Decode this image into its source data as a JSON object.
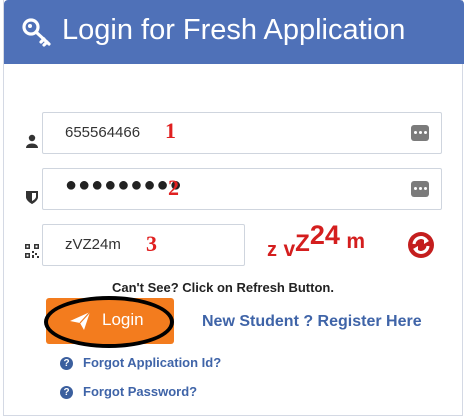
{
  "header": {
    "title": "Login for Fresh Application",
    "bg_color": "#4f71b8",
    "icon": "key-icon"
  },
  "fields": {
    "application_id": {
      "value": "655564466",
      "annotation": "1",
      "icon": "user-icon"
    },
    "password": {
      "value": "●●●●●●●●●",
      "annotation": "2",
      "icon": "shield-icon"
    },
    "captcha": {
      "value": "zVZ24m",
      "annotation": "3",
      "icon": "qr-code-icon"
    }
  },
  "captcha_image": {
    "part1": "z",
    "part2": "v",
    "part3": "Z",
    "part4": "24",
    "part5": "m",
    "color": "#d41e1e"
  },
  "hint": "Can't See? Click on Refresh Button.",
  "login_button": {
    "label": "Login",
    "color": "#f37c1e"
  },
  "register_link": "New Student ? Register Here",
  "forgot_links": [
    {
      "label": "Forgot Application Id?"
    },
    {
      "label": "Forgot Password?"
    }
  ],
  "annotation_color": "#e02020",
  "link_color": "#3f64a8"
}
